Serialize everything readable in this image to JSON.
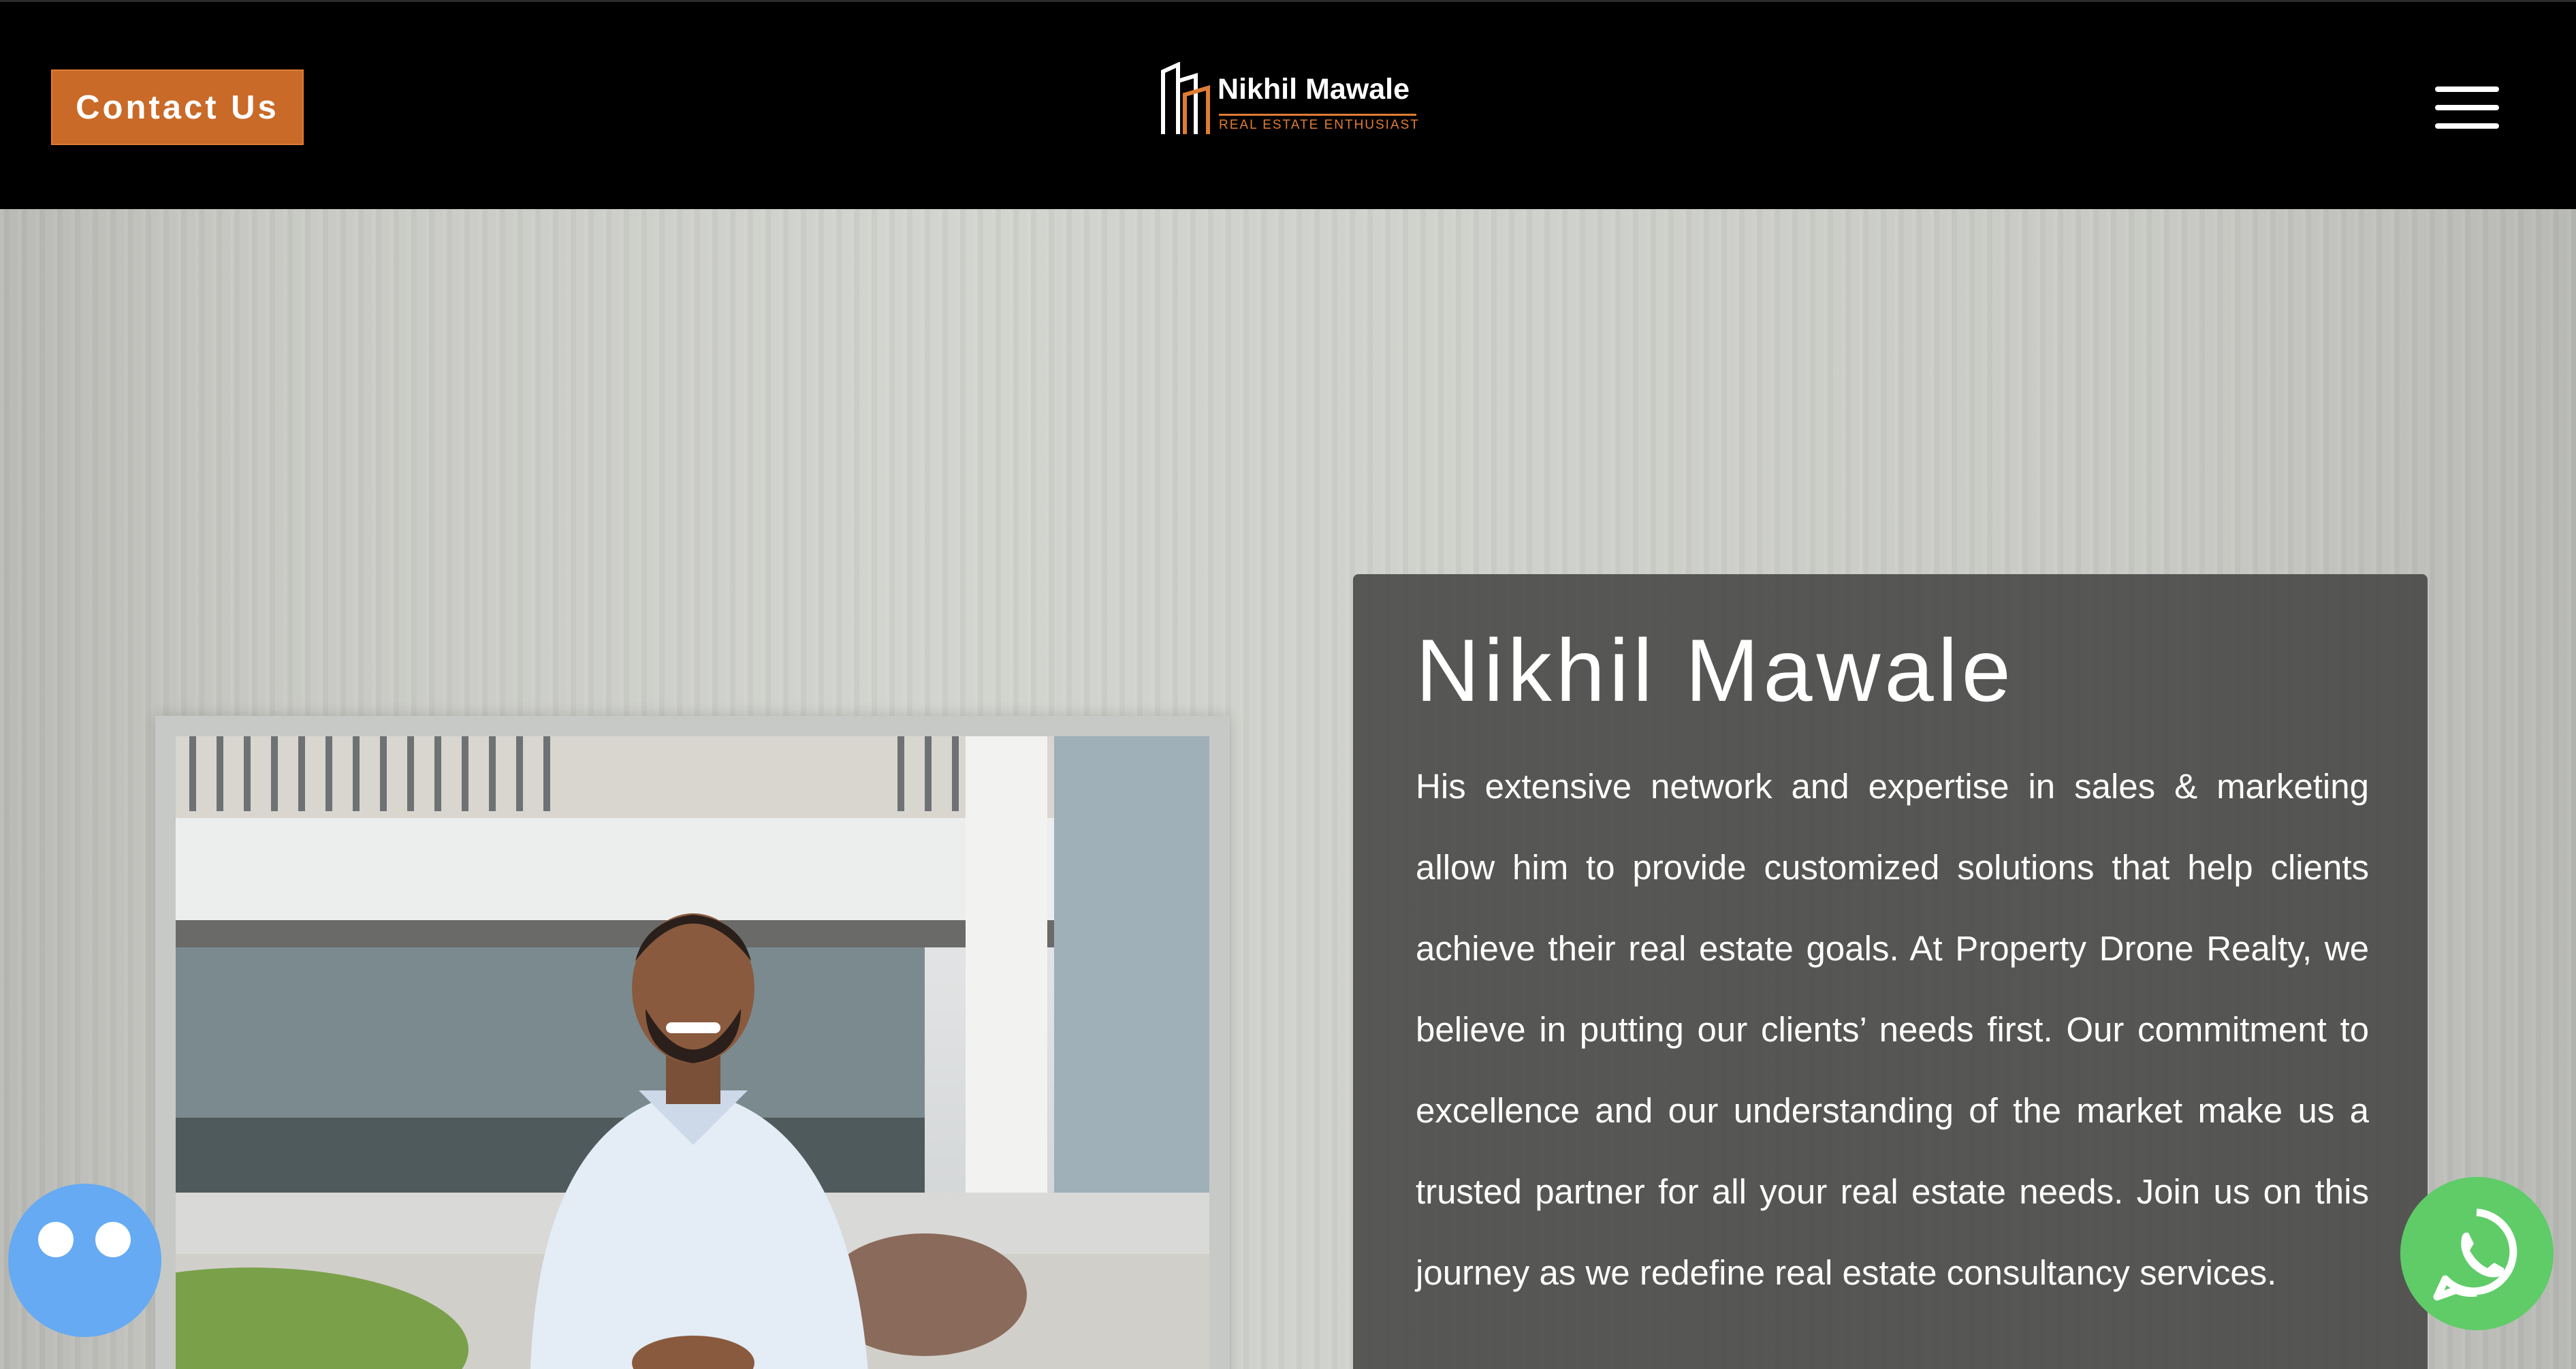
{
  "header": {
    "contact_button": "Contact Us",
    "logo": {
      "name": "Nikhil Mawale",
      "tagline": "REAL ESTATE ENTHUSIAST"
    },
    "menu_icon": "hamburger-menu-icon"
  },
  "hero": {
    "title": "Nikhil Mawale",
    "body": "His extensive network and expertise in sales & marketing allow him to provide customized solutions that help clients achieve their real estate goals. At Property Drone Realty, we believe in putting our clients’ needs first. Our commitment to excellence and our understanding of the market make us a trusted partner for all your real estate needs. Join us on this journey as we redefine real estate consultancy services.",
    "prev_icon": "chevron-left-icon",
    "next_icon": "chevron-right-icon"
  },
  "floating": {
    "chat_icon": "chat-bot-icon",
    "whatsapp_icon": "whatsapp-icon"
  },
  "colors": {
    "accent": "#c96a28",
    "header_bg": "#000000",
    "card_bg": "#464644",
    "chat": "#65aaf2",
    "whatsapp": "#5fcc68"
  }
}
